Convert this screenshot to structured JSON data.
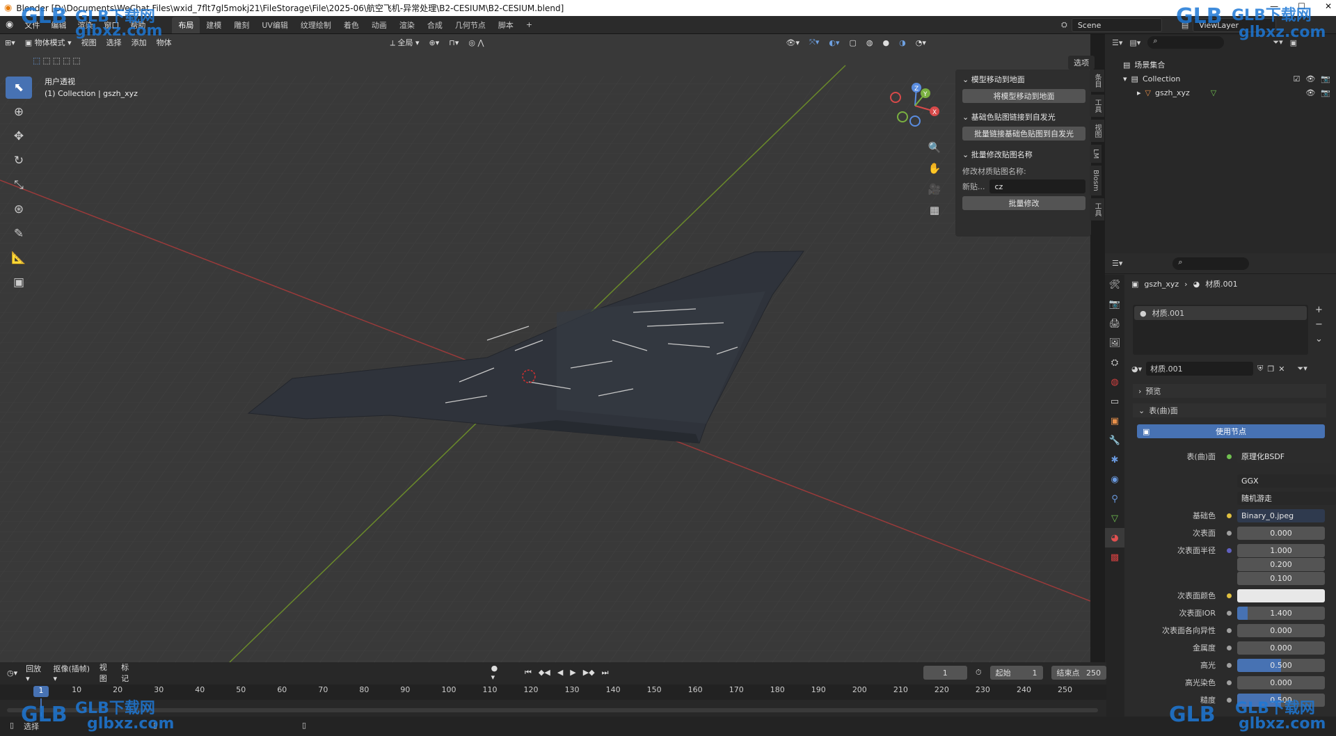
{
  "window": {
    "title": "Blender [D:\\Documents\\WeChat Files\\wxid_7flt7gl5mokj21\\FileStorage\\File\\2025-06\\航空飞机-异常处理\\B2-CESIUM\\B2-CESIUM.blend]"
  },
  "menus": [
    "文件",
    "编辑",
    "渲染",
    "窗口",
    "帮助"
  ],
  "workspaces": [
    "布局",
    "建模",
    "雕刻",
    "UV编辑",
    "纹理绘制",
    "着色",
    "动画",
    "渲染",
    "合成",
    "几何节点",
    "脚本"
  ],
  "active_workspace": "布局",
  "scene_name": "Scene",
  "view_layer": "ViewLayer",
  "viewport_header": {
    "mode": "物体模式",
    "menus": [
      "视图",
      "选择",
      "添加",
      "物体"
    ],
    "transform": "全局",
    "options": "选项"
  },
  "viewport_info": {
    "line1": "用户透视",
    "line2": "(1) Collection | gszh_xyz"
  },
  "npanel": {
    "sec1_title": "模型移动到地面",
    "sec1_btn": "将模型移动到地面",
    "sec2_title": "基础色贴图链接到自发光",
    "sec2_btn": "批量链接基础色贴图到自发光",
    "sec3_title": "批量修改贴图名称",
    "sec3_label": "修改材质贴图名称:",
    "new_label": "新贴...",
    "new_value": "cz",
    "sec3_btn": "批量修改",
    "tabs": [
      "条目",
      "工具",
      "视图",
      "LM",
      "Blosm",
      "工具"
    ]
  },
  "outliner": {
    "root": "场景集合",
    "collection": "Collection",
    "object": "gszh_xyz"
  },
  "properties": {
    "breadcrumb_obj": "gszh_xyz",
    "breadcrumb_mat": "材质.001",
    "slot": "材质.001",
    "material_name": "材质.001",
    "preview": "预览",
    "surface_panel": "表(曲)面",
    "use_nodes": "使用节点",
    "rows": [
      {
        "label": "表(曲)面",
        "value": "原理化BSDF"
      },
      {
        "label": "",
        "value": "GGX"
      },
      {
        "label": "",
        "value": "随机游走"
      },
      {
        "label": "基础色",
        "value": "Binary_0.jpeg"
      },
      {
        "label": "次表面",
        "value": "0.000"
      },
      {
        "label": "次表面半径",
        "value": "1.000"
      },
      {
        "label": "",
        "value": "0.200"
      },
      {
        "label": "",
        "value": "0.100"
      },
      {
        "label": "次表面颜色",
        "value": ""
      },
      {
        "label": "次表面IOR",
        "value": "1.400"
      },
      {
        "label": "次表面各向异性",
        "value": "0.000"
      },
      {
        "label": "金属度",
        "value": "0.000"
      },
      {
        "label": "高光",
        "value": "0.500"
      },
      {
        "label": "高光染色",
        "value": "0.000"
      },
      {
        "label": "糙度",
        "value": "0.500"
      }
    ]
  },
  "timeline": {
    "menus": [
      "回放",
      "抠像(插帧)",
      "视图",
      "标记"
    ],
    "current_frame": "1",
    "start_label": "起始",
    "start": "1",
    "end_label": "结束点",
    "end": "250",
    "ticks": [
      "1",
      "10",
      "20",
      "30",
      "40",
      "50",
      "60",
      "70",
      "80",
      "90",
      "100",
      "110",
      "120",
      "130",
      "140",
      "150",
      "160",
      "170",
      "180",
      "190",
      "200",
      "210",
      "220",
      "230",
      "240",
      "250"
    ]
  },
  "statusbar": {
    "left": "选择"
  },
  "watermark": {
    "brand": "GLB下载网",
    "site": "glbxz.com",
    "logo": "GLB"
  }
}
